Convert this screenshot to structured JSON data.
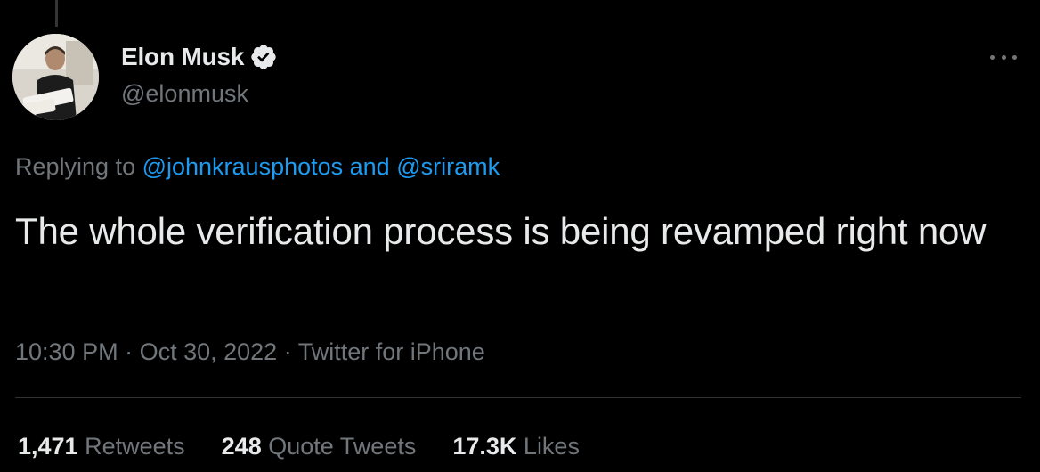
{
  "user": {
    "display_name": "Elon Musk",
    "handle": "@elonmusk",
    "verified": true
  },
  "reply": {
    "prefix": "Replying to ",
    "mention_1": "@johnkrausphotos",
    "conjunction": " and ",
    "mention_2": "@sriramk"
  },
  "tweet": {
    "text": "The whole verification process is being revamped right now"
  },
  "meta": {
    "time": "10:30 PM",
    "separator_1": " · ",
    "date": "Oct 30, 2022",
    "separator_2": " · ",
    "source": "Twitter for iPhone"
  },
  "stats": {
    "retweets_count": "1,471",
    "retweets_label": "Retweets",
    "quotes_count": "248",
    "quotes_label": "Quote Tweets",
    "likes_count": "17.3K",
    "likes_label": "Likes"
  },
  "colors": {
    "background": "#000000",
    "text_primary": "#e7e9ea",
    "text_secondary": "#71767b",
    "link": "#1d9bf0",
    "verified_badge": "#e7e9ea"
  },
  "icons": {
    "verified": "verified-badge-icon",
    "more": "more-horizontal-icon"
  }
}
